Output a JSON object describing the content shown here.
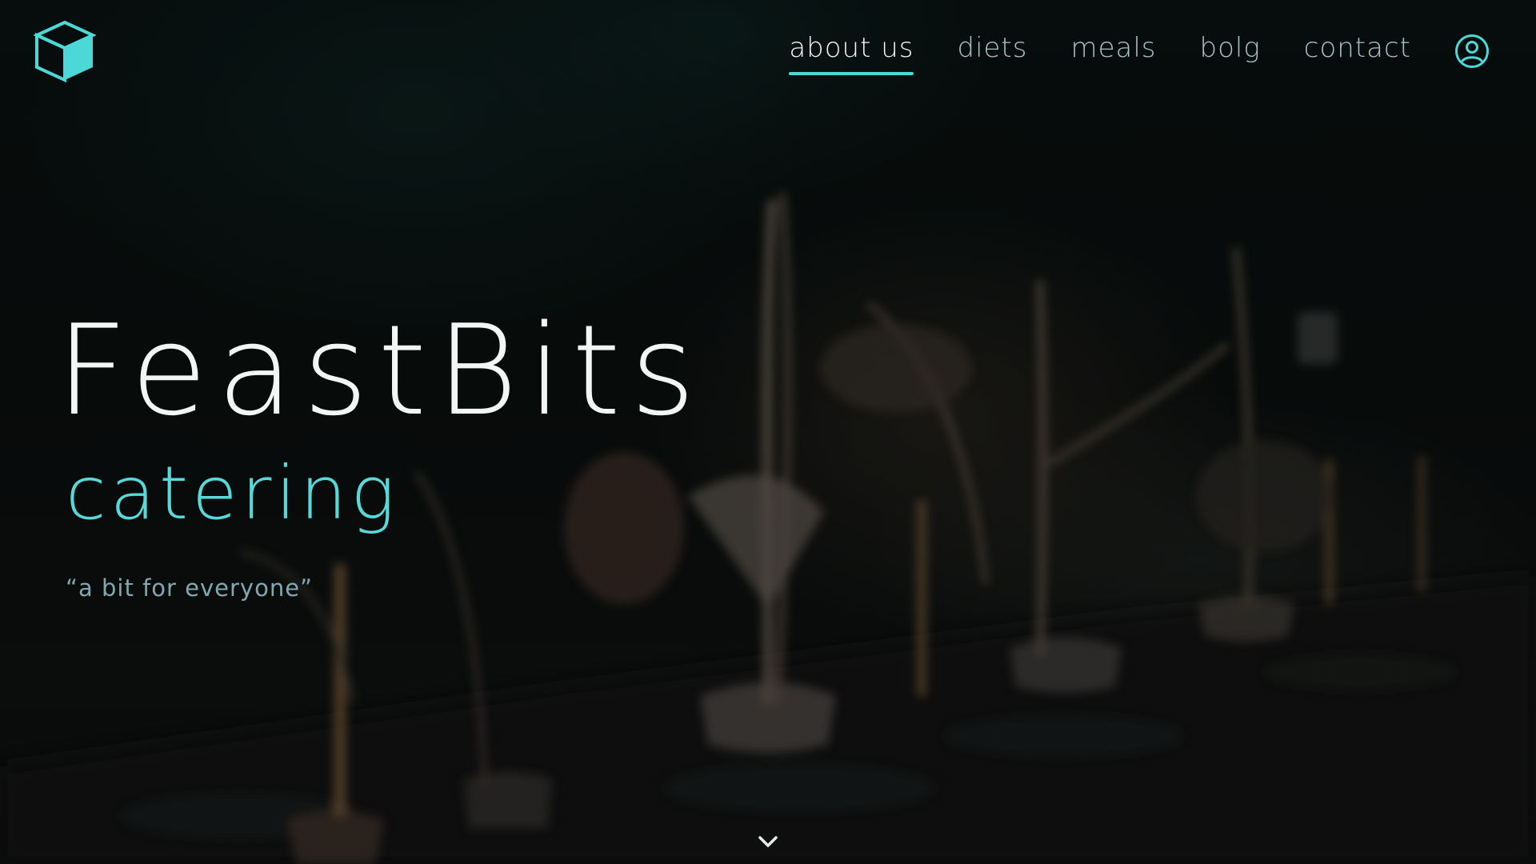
{
  "brand": {
    "logo_icon": "cube-icon",
    "accent_color": "#4dd8d8"
  },
  "nav": {
    "items": [
      {
        "label": "about us",
        "active": true
      },
      {
        "label": "diets",
        "active": false
      },
      {
        "label": "meals",
        "active": false
      },
      {
        "label": "bolg",
        "active": false
      },
      {
        "label": "contact",
        "active": false
      }
    ],
    "account_icon": "user-icon"
  },
  "hero": {
    "title": "FeastBits",
    "subtitle": "catering",
    "tagline": "“a bit for everyone”"
  },
  "scroll": {
    "icon": "chevron-down-icon"
  }
}
